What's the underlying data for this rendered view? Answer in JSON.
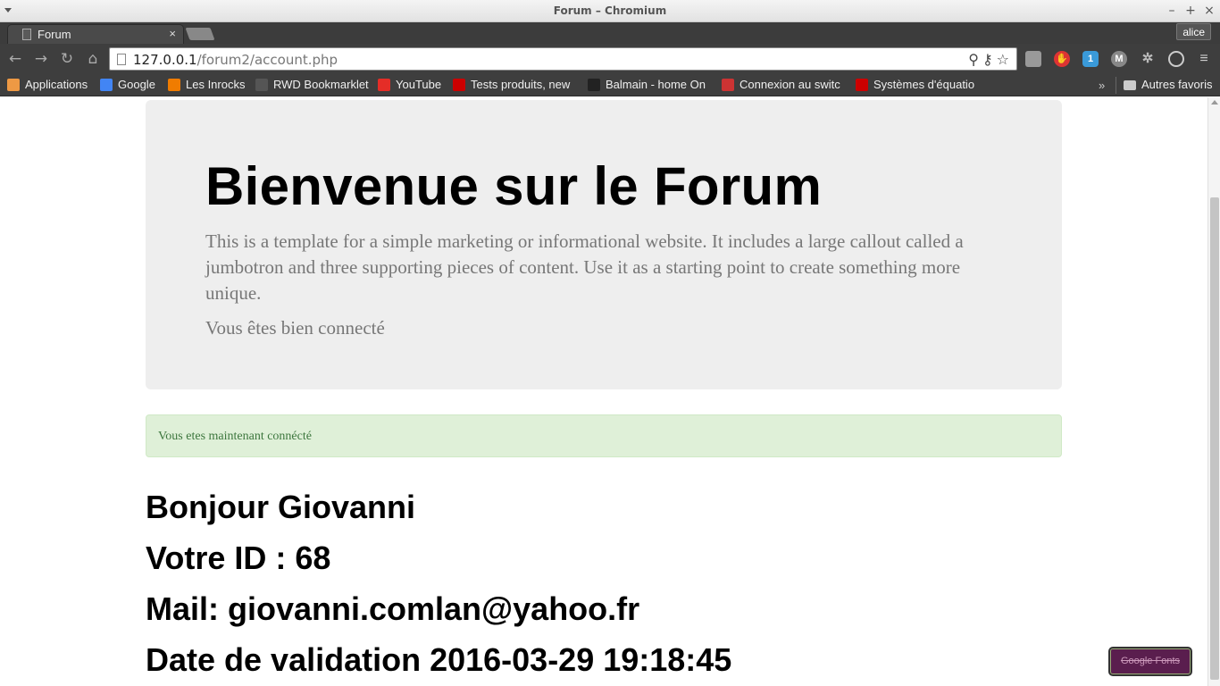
{
  "window": {
    "title": "Forum – Chromium",
    "profile": "alice"
  },
  "tab": {
    "title": "Forum"
  },
  "address_bar": {
    "host": "127.0.0.1",
    "path": "/forum2/account.php"
  },
  "bookmarks": [
    {
      "label": "Applications",
      "icon": "apps-grid-icon",
      "color": "#e94"
    },
    {
      "label": "Google",
      "icon": "google-icon",
      "color": "#4285f4"
    },
    {
      "label": "Les Inrocks",
      "icon": "inrocks-icon",
      "color": "#f07c00"
    },
    {
      "label": "RWD Bookmarklet",
      "icon": "page-icon",
      "color": "#555"
    },
    {
      "label": "YouTube",
      "icon": "youtube-icon",
      "color": "#e52d27"
    },
    {
      "label": "Tests produits, new",
      "icon": "clubic-icon",
      "color": "#c00"
    },
    {
      "label": "Balmain - home On",
      "icon": "balmain-icon",
      "color": "#222"
    },
    {
      "label": "Connexion au switc",
      "icon": "shield-icon",
      "color": "#c33"
    },
    {
      "label": "Systèmes d'équatio",
      "icon": "free-icon",
      "color": "#c00"
    }
  ],
  "bookmarks_more": "»",
  "other_bookmarks": "Autres favoris",
  "jumbotron": {
    "heading": "Bienvenue sur le Forum",
    "lead": "This is a template for a simple marketing or informational website. It includes a large callout called a jumbotron and three supporting pieces of content. Use it as a starting point to create something more unique.",
    "status": "Vous êtes bien connecté"
  },
  "alert": {
    "message": "Vous etes maintenant connécté"
  },
  "account": {
    "greeting": "Bonjour Giovanni",
    "id_line": "Votre ID : 68",
    "mail_line": "Mail: giovanni.comlan@yahoo.fr",
    "validation_line": "Date de validation 2016-03-29 19:18:45"
  },
  "google_fonts_button": "Google Fonts"
}
